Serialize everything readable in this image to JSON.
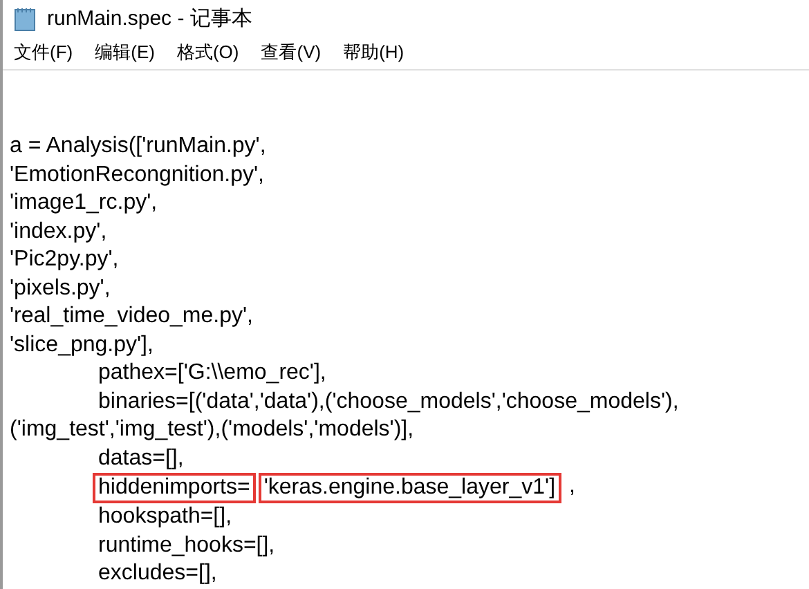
{
  "window": {
    "title": "runMain.spec - 记事本"
  },
  "menu": [
    "文件(F)",
    "编辑(E)",
    "格式(O)",
    "查看(V)",
    "帮助(H)"
  ],
  "lines": [
    {
      "indented": false,
      "segments": [
        {
          "text": "a = Analysis(['runMain.py',",
          "boxed": false
        }
      ]
    },
    {
      "indented": false,
      "segments": [
        {
          "text": "'EmotionRecongnition.py',",
          "boxed": false
        }
      ]
    },
    {
      "indented": false,
      "segments": [
        {
          "text": "'image1_rc.py',",
          "boxed": false
        }
      ]
    },
    {
      "indented": false,
      "segments": [
        {
          "text": "'index.py',",
          "boxed": false
        }
      ]
    },
    {
      "indented": false,
      "segments": [
        {
          "text": "'Pic2py.py',",
          "boxed": false
        }
      ]
    },
    {
      "indented": false,
      "segments": [
        {
          "text": "'pixels.py',",
          "boxed": false
        }
      ]
    },
    {
      "indented": false,
      "segments": [
        {
          "text": "'real_time_video_me.py',",
          "boxed": false
        }
      ]
    },
    {
      "indented": false,
      "segments": [
        {
          "text": "'slice_png.py'],",
          "boxed": false
        }
      ]
    },
    {
      "indented": true,
      "segments": [
        {
          "text": "pathex=['G:\\\\emo_rec'],",
          "boxed": false
        }
      ]
    },
    {
      "indented": true,
      "segments": [
        {
          "text": "binaries=[('data','data'),('choose_models','choose_models'),",
          "boxed": false
        }
      ]
    },
    {
      "indented": false,
      "segments": [
        {
          "text": "('img_test','img_test'),('models','models')],",
          "boxed": false
        }
      ]
    },
    {
      "indented": true,
      "segments": [
        {
          "text": "datas=[],",
          "boxed": false
        }
      ]
    },
    {
      "indented": true,
      "segments": [
        {
          "text": "hiddenimports=",
          "boxed": true
        },
        {
          "text": "'keras.engine.base_layer_v1']",
          "boxed": true
        },
        {
          "text": ",",
          "boxed": false
        }
      ]
    },
    {
      "indented": true,
      "segments": [
        {
          "text": "hookspath=[],",
          "boxed": false
        }
      ]
    },
    {
      "indented": true,
      "segments": [
        {
          "text": "runtime_hooks=[],",
          "boxed": false
        }
      ]
    },
    {
      "indented": true,
      "segments": [
        {
          "text": "excludes=[],",
          "boxed": false
        }
      ]
    }
  ]
}
